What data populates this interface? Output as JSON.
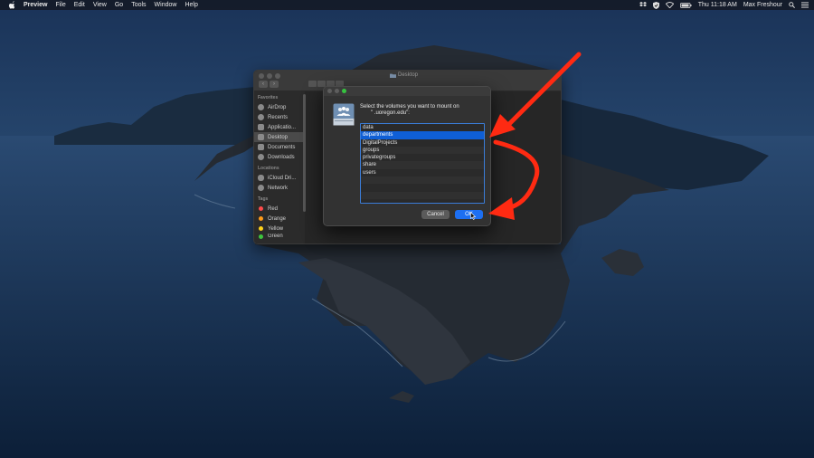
{
  "menubar": {
    "items": [
      {
        "label": "Preview",
        "bold": true
      },
      {
        "label": "File"
      },
      {
        "label": "Edit"
      },
      {
        "label": "View"
      },
      {
        "label": "Go"
      },
      {
        "label": "Tools"
      },
      {
        "label": "Window"
      },
      {
        "label": "Help"
      }
    ],
    "clock": "Thu 11:18 AM",
    "user": "Max Freshour"
  },
  "finder": {
    "title": "Desktop",
    "favorites_header": "Favorites",
    "favorites": [
      "AirDrop",
      "Recents",
      "Applicatio...",
      "Desktop",
      "Documents",
      "Downloads"
    ],
    "selected_favorite": "Desktop",
    "locations_header": "Locations",
    "locations": [
      "iCloud Dri...",
      "Network"
    ],
    "tags_header": "Tags",
    "tags": [
      {
        "label": "Red",
        "color": "#ff4b4b"
      },
      {
        "label": "Orange",
        "color": "#ff9b1a"
      },
      {
        "label": "Yellow",
        "color": "#ffd21a"
      },
      {
        "label": "Green",
        "color": "#3ec43e"
      }
    ]
  },
  "dialog": {
    "prompt_line1": "Select the volumes you want to mount on",
    "prompt_line2": "\"          .uoregon.edu\":",
    "volumes": [
      "data",
      "departments",
      "DigitalProjects",
      "groups",
      "privategroups",
      "share",
      "users"
    ],
    "selected_index": 1,
    "empty_rows": 3,
    "cancel_label": "Cancel",
    "ok_label": "OK"
  },
  "colors": {
    "accent": "#1d6ff2",
    "selection": "#0f5fd6",
    "arrow": "#ff2a12"
  }
}
